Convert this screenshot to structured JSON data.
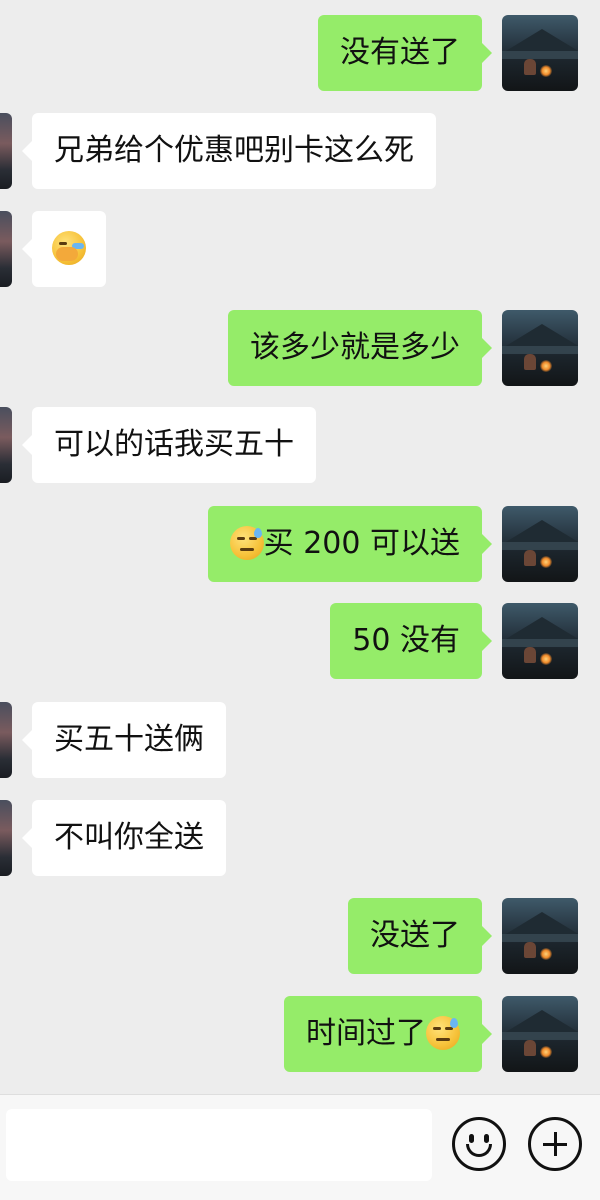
{
  "messages": [
    {
      "sender": "me",
      "text": "没有送了"
    },
    {
      "sender": "them",
      "text": "兄弟给个优惠吧别卡这么死"
    },
    {
      "sender": "them",
      "emoji": "facepalm-laughing-emoji"
    },
    {
      "sender": "me",
      "text": "该多少就是多少"
    },
    {
      "sender": "them",
      "text": "可以的话我买五十"
    },
    {
      "sender": "me",
      "emoji_prefix": "sweat-smile-emoji",
      "text": "买 200 可以送"
    },
    {
      "sender": "me",
      "text": "50 没有"
    },
    {
      "sender": "them",
      "text": "买五十送俩"
    },
    {
      "sender": "them",
      "text": "不叫你全送"
    },
    {
      "sender": "me",
      "text": "没送了"
    },
    {
      "sender": "me",
      "text": "时间过了",
      "emoji_suffix": "sweat-smile-emoji"
    }
  ],
  "input": {
    "value": "",
    "placeholder": ""
  },
  "footer": {
    "emoji_button_icon": "smiley-icon",
    "plus_button_icon": "plus-circle-icon"
  },
  "colors": {
    "background": "#ededed",
    "outgoing_bubble": "#95ec69",
    "incoming_bubble": "#ffffff",
    "footer": "#f7f7f7"
  }
}
